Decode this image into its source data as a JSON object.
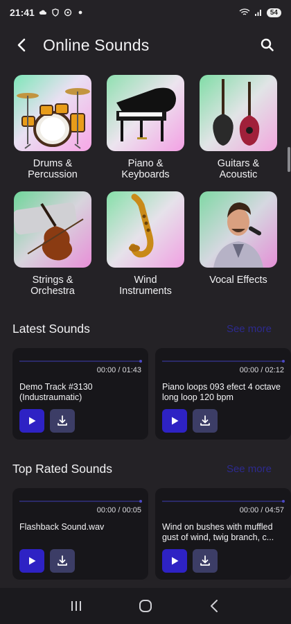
{
  "status_bar": {
    "time": "21:41",
    "battery": "54"
  },
  "header": {
    "title": "Online Sounds"
  },
  "categories": [
    {
      "label": "Drums &\nPercussion",
      "icon": "drums-image"
    },
    {
      "label": "Piano &\nKeyboards",
      "icon": "piano-image"
    },
    {
      "label": "Guitars &\nAcoustic",
      "icon": "guitars-image"
    },
    {
      "label": "Strings &\nOrchestra",
      "icon": "violin-image"
    },
    {
      "label": "Wind\nInstruments",
      "icon": "saxophone-image"
    },
    {
      "label": "Vocal Effects",
      "icon": "singer-image"
    }
  ],
  "latest": {
    "title": "Latest Sounds",
    "see_more": "See more",
    "items": [
      {
        "time": "00:00 / 01:43",
        "name": "Demo Track #3130 (Industraumatic)"
      },
      {
        "time": "00:00 / 02:12",
        "name": "Piano loops 093 efect 4 octave long loop 120 bpm"
      }
    ]
  },
  "top_rated": {
    "title": "Top Rated Sounds",
    "see_more": "See more",
    "items": [
      {
        "time": "00:00 / 00:05",
        "name": "Flashback Sound.wav"
      },
      {
        "time": "00:00 / 04:57",
        "name": "Wind on bushes with muffled gust of wind, twig branch, c..."
      }
    ]
  },
  "colors": {
    "background": "#242226",
    "card": "#17161a",
    "play": "#2e22c4",
    "download": "#3c3d66",
    "see_more": "#2d2a8e"
  }
}
